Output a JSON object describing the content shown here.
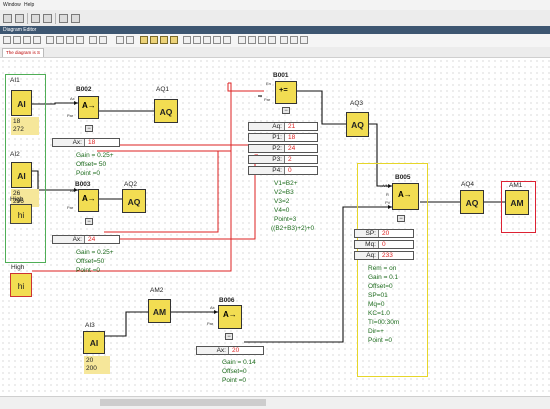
{
  "menu": {
    "window": "Window",
    "help": "Help"
  },
  "editor": {
    "title": "Diagram Editor",
    "tab": "The diagram is S"
  },
  "blocks": {
    "ai1": {
      "name": "AI1",
      "type": "AI",
      "v1": "18",
      "v2": "272"
    },
    "ai2": {
      "name": "AI2",
      "type": "AI",
      "v1": "26",
      "v2": "296"
    },
    "ai3": {
      "name": "AI3",
      "type": "AI",
      "v1": "20",
      "v2": "200"
    },
    "high1": {
      "name": "High",
      "type": "hi"
    },
    "high2": {
      "name": "High",
      "type": "hi"
    },
    "aq1": {
      "name": "AQ1",
      "type": "AQ"
    },
    "aq2": {
      "name": "AQ2",
      "type": "AQ"
    },
    "aq3": {
      "name": "AQ3",
      "type": "AQ"
    },
    "aq4": {
      "name": "AQ4",
      "type": "AQ"
    },
    "am1": {
      "name": "AM1",
      "type": "AM"
    },
    "am2": {
      "name": "AM2",
      "type": "AM"
    },
    "b001": {
      "name": "B001"
    },
    "b002": {
      "name": "B002"
    },
    "b003": {
      "name": "B003"
    },
    "b005": {
      "name": "B005"
    },
    "b006": {
      "name": "B006"
    }
  },
  "b002_params": {
    "ax_key": "Ax:",
    "ax_val": "18",
    "gain": "Gain = 0.25+",
    "offset": "Offset= 50",
    "point": "Point =0"
  },
  "b003_params": {
    "ax_key": "Ax:",
    "ax_val": "24",
    "gain": "Gain = 0.25+",
    "offset": "Offset=50",
    "point": "Point =0"
  },
  "b006_params": {
    "ax_key": "Ax:",
    "ax_val": "20",
    "gain": "Gain = 0.14",
    "offset": "Offset=0",
    "point": "Point =0"
  },
  "b001_params": {
    "rows": [
      {
        "k": "Aq:",
        "v": "21"
      },
      {
        "k": "P1:",
        "v": "18"
      },
      {
        "k": "P2:",
        "v": "24"
      },
      {
        "k": "P3:",
        "v": "2"
      },
      {
        "k": "P4:",
        "v": "0"
      }
    ],
    "v1": "V1=B2+",
    "v2": "V2=B3",
    "v3": "V3=2",
    "v4": "V4=0",
    "point": "Point=3",
    "formula": "((B2+B3)+2)+0"
  },
  "b005_params": {
    "rows": [
      {
        "k": "SP:",
        "v": "20"
      },
      {
        "k": "Mq:",
        "v": "0"
      },
      {
        "k": "Aq:",
        "v": "233"
      }
    ],
    "rem": "Rem = on",
    "gain": "Gain = 0.1",
    "offset": "Offset=0",
    "sp": "SP=01",
    "mq": "Mq=0",
    "kc": "KC=1.0",
    "ti": "TI=00:30m",
    "dir": "Dir=+",
    "point": "Point =0"
  },
  "fb_symbols": {
    "amp": "A→",
    "math": "+=",
    "pid": "A→"
  },
  "pin_labels": {
    "ax": "Ax",
    "par": "Par",
    "en": "En",
    "am": "A/M",
    "r": "R",
    "pv": "PV"
  },
  "colors": {
    "block": "#f2dd52",
    "wire": "#111111",
    "red_wire": "#d22222",
    "green_frame": "#4fae56",
    "yellow_frame": "#e6d62a",
    "red_frame": "#d22233",
    "title_bar": "#3d5671"
  }
}
